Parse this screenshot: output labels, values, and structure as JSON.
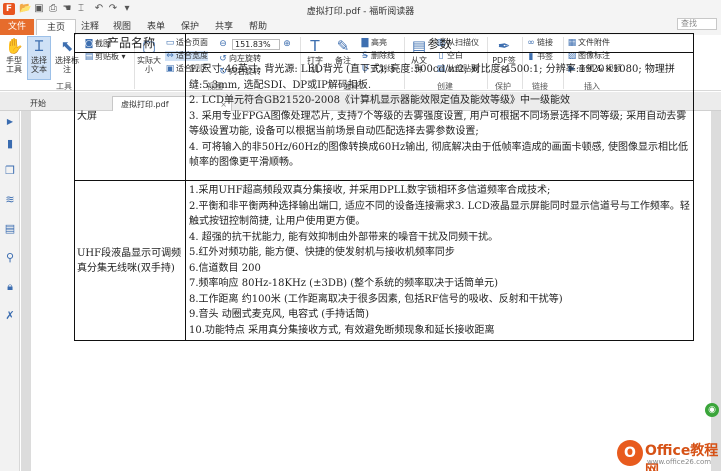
{
  "window": {
    "title": "虚拟打印.pdf - 福昕阅读器"
  },
  "menu": {
    "file": "文件",
    "tabs": [
      "主页",
      "注释",
      "视图",
      "表单",
      "保护",
      "共享",
      "帮助"
    ],
    "search_placeholder": "查找"
  },
  "ribbon": {
    "tools": {
      "hand": "手型工具",
      "select_text": "选择文本",
      "select_annot": "选择标注",
      "screenshot": "截图",
      "clipboard": "剪贴板",
      "group": "工具"
    },
    "view": {
      "actual": "实际大小",
      "fit_page": "适合页面",
      "fit_width": "适合宽度",
      "fit_visible": "适合视区",
      "zoom": "151.83%",
      "rotate_left": "向左旋转",
      "rotate_right": "向右旋转",
      "group": "视图"
    },
    "comment": {
      "typewriter": "打字机",
      "note": "备注",
      "highlight": "高亮",
      "strikeout": "删除线",
      "underline": "下划线",
      "group": "注释"
    },
    "create": {
      "from_file": "从文件",
      "from_scanner": "从扫描仪",
      "blank": "空白",
      "from_clipboard": "从剪贴板",
      "group": "创建"
    },
    "protect": {
      "pdf_sign": "PDF签名",
      "group": "保护"
    },
    "links": {
      "link": "链接",
      "bookmark": "书签",
      "group": "链接"
    },
    "insert": {
      "attachment": "文件附件",
      "image_annot": "图像标注",
      "audio_video": "音频 & 视频",
      "group": "插入"
    }
  },
  "doc_tabs": [
    "开始",
    "虚拟打印.pdf"
  ],
  "table": {
    "headers": [
      "产品名称",
      "参数"
    ],
    "rows": [
      {
        "name": "大屏",
        "params": [
          "1. 尺寸:46英寸; 背光源: LED背光 (直下式); 亮度:500cd/m2; 对比度:4500:1; 分辨率:1920×1080; 物理拼缝:5.3mm, 选配SDI、DP或IP解码扣板.",
          "2. LCD单元符合GB21520-2008《计算机显示器能效限定值及能效等级》中一级能效",
          "3. 采用专业FPGA图像处理芯片, 支持7个等级的去雾强度设置, 用户可根据不同场景选择不同等级; 采用自动去雾等级设置功能, 设备可以根据当前场景自动匹配选择去雾参数设置;",
          "4. 可将输入的非50Hz/60Hz的图像转换成60Hz输出, 彻底解决由于低帧率造成的画面卡顿感, 使图像显示相比低帧率的图像更平滑顺畅。"
        ]
      },
      {
        "name": "UHF段液晶显示可调频真分集无线咪(双手持)",
        "params": [
          "1.采用UHF超高频段双真分集接收, 并采用DPLL数字锁相环多信道频率合成技术;",
          "2.平衡和非平衡两种选择输出端口, 适应不同的设备连接需求3. LCD液晶显示屏能同时显示信道号与工作频率。轻触式按钮控制简捷, 让用户使用更方便。",
          "4. 超强的抗干扰能力, 能有效抑制由外部带来的噪音干扰及同频干扰。",
          "5.红外对频功能, 能方便、快捷的使发射机与接收机频率同步",
          "6.信道数目 200",
          "7.频率响应 80Hz-18KHz (±3DB) (整个系统的频率取决于话筒单元)",
          "8.工作距离 约100米 (工作距离取决于很多因素, 包括RF信号的吸收、反射和干扰等)",
          "9.音头 动圈式麦克风, 电容式 (手持话筒)",
          "10.功能特点 采用真分集接收方式, 有效避免断频现象和延长接收距离"
        ]
      }
    ]
  },
  "watermark": {
    "brand": "Office教程网",
    "url": "www.office26.com"
  }
}
